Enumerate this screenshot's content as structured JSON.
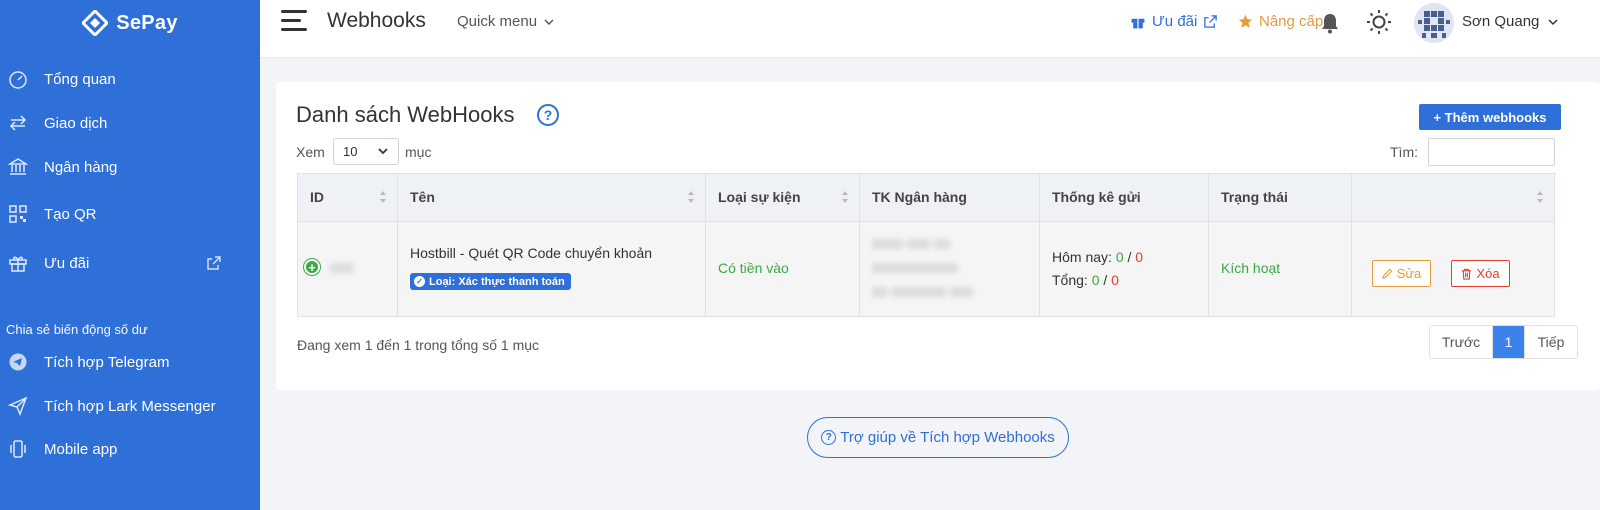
{
  "brand": {
    "name": "SePay"
  },
  "sidebar": {
    "items": [
      {
        "label": "Tổng quan",
        "icon": "dashboard-icon"
      },
      {
        "label": "Giao dịch",
        "icon": "transfer-icon"
      },
      {
        "label": "Ngân hàng",
        "icon": "bank-icon"
      },
      {
        "label": "Tạo QR",
        "icon": "qr-icon"
      },
      {
        "label": "Ưu đãi",
        "icon": "gift-icon"
      }
    ],
    "section_label": "Chia sẻ biến động số dư",
    "section_items": [
      {
        "label": "Tích hợp Telegram",
        "icon": "telegram-icon"
      },
      {
        "label": "Tích hợp Lark Messenger",
        "icon": "send-icon"
      },
      {
        "label": "Mobile app",
        "icon": "mobile-icon"
      }
    ]
  },
  "header": {
    "title": "Webhooks",
    "quick_menu": "Quick menu",
    "promo": "Ưu đãi",
    "upgrade": "Nâng cấp",
    "user_name": "Sơn Quang"
  },
  "card": {
    "title": "Danh sách WebHooks",
    "add_button": "+ Thêm webhooks",
    "length_label": "Xem",
    "length_value": "10",
    "length_after": "mục",
    "search_label": "Tìm:",
    "columns": [
      "ID",
      "Tên",
      "Loại sự kiện",
      "TK Ngân hàng",
      "Thống kê gửi",
      "Trạng thái",
      ""
    ],
    "row": {
      "id": "000",
      "name": "Hostbill - Quét QR Code chuyển khoản",
      "type_badge": "Loại: Xác thực thanh toán",
      "event": "Có tiền vào",
      "bank_lines": [
        "0000 000 00",
        "00000000000",
        "00 0000000 000"
      ],
      "stats_today_label": "Hôm nay:",
      "stats_today_success": "0",
      "stats_today_fail": "0",
      "stats_total_label": "Tổng:",
      "stats_total_success": "0",
      "stats_total_fail": "0",
      "separator": "/",
      "status": "Kích hoạt",
      "edit_label": "Sửa",
      "delete_label": "Xóa"
    },
    "info": "Đang xem 1 đến 1 trong tổng số 1 mục",
    "pagination": {
      "prev": "Trước",
      "current": "1",
      "next": "Tiếp"
    }
  },
  "help_button": "Trợ giúp về Tích hợp Webhooks",
  "colors": {
    "primary": "#2f6fd8",
    "success": "#3aa845",
    "danger": "#e0412e",
    "warning": "#e59b3c"
  }
}
